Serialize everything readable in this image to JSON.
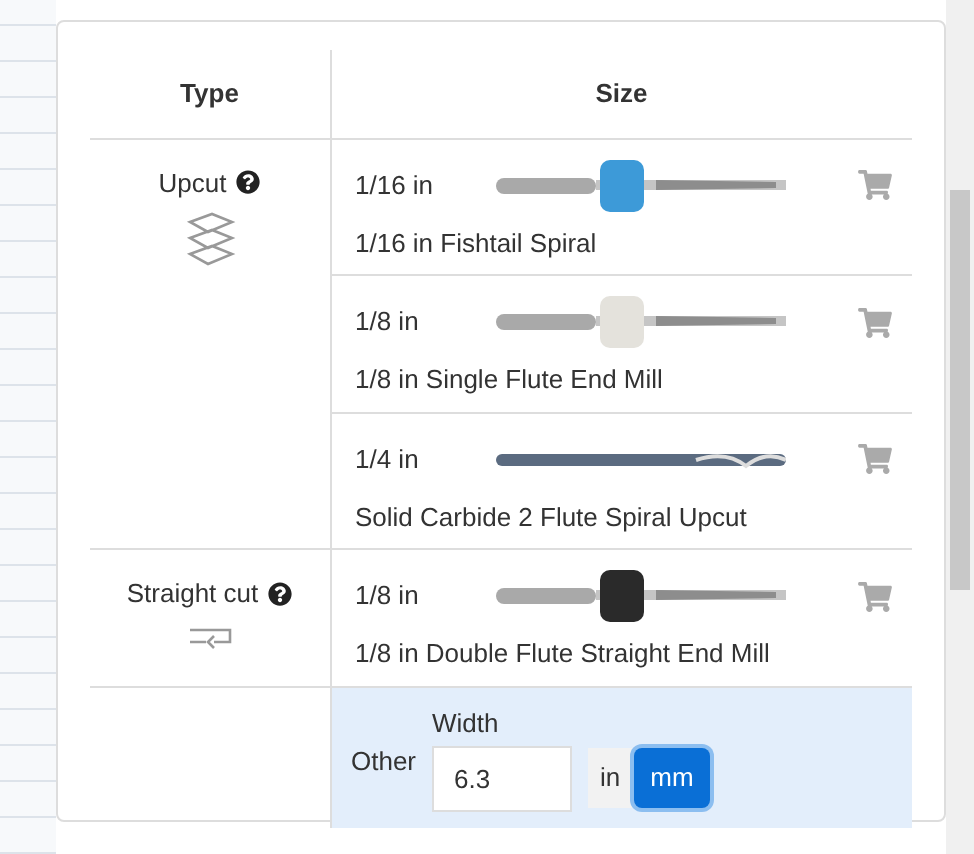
{
  "table": {
    "columns": [
      "Type",
      "Size"
    ],
    "groups": [
      {
        "kind": "upcut",
        "label": "Upcut",
        "bits": [
          {
            "size": "1/16 in",
            "name": "1/16 in Fishtail Spiral",
            "kind": "collared",
            "color": "#3d9ad8"
          },
          {
            "size": "1/8 in",
            "name": "1/8 in Single Flute End Mill",
            "kind": "collared",
            "color": "#e4e2dc"
          },
          {
            "size": "1/4 in",
            "name": "Solid Carbide 2 Flute Spiral Upcut",
            "kind": "plain"
          }
        ]
      },
      {
        "kind": "straight",
        "label": "Straight cut",
        "bits": [
          {
            "size": "1/8 in",
            "name": "1/8 in Double Flute Straight End Mill",
            "kind": "collared",
            "color": "#2a2a2a"
          }
        ]
      }
    ],
    "other": {
      "label": "Other",
      "field_label": "Width",
      "value": "6.3",
      "units": [
        {
          "label": "in",
          "selected": false
        },
        {
          "label": "mm",
          "selected": true
        }
      ]
    }
  }
}
